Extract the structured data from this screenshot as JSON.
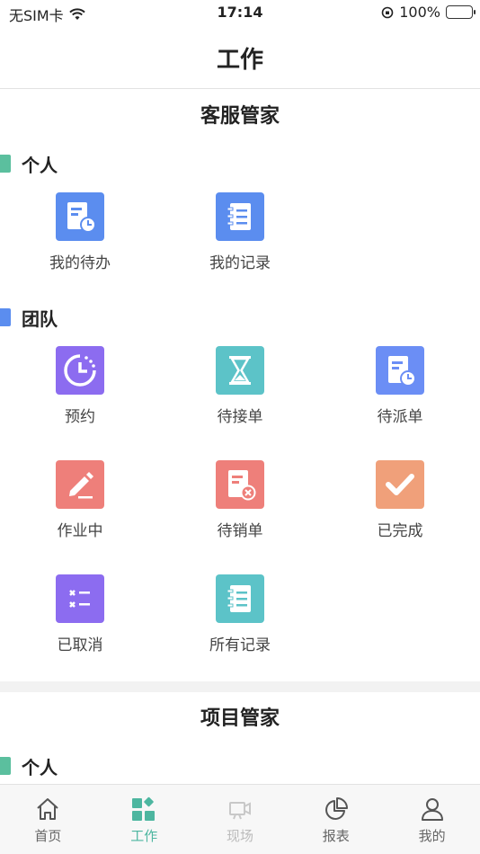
{
  "status": {
    "carrier": "无SIM卡",
    "time": "17:14",
    "battery": "100%",
    "battery_level": 1.0
  },
  "nav": {
    "title": "工作"
  },
  "sections": [
    {
      "title": "客服管家",
      "groups": [
        {
          "title": "个人",
          "bar_color": "#5bbf9e",
          "items": [
            {
              "label": "我的待办",
              "icon": "todo-clock-icon",
              "color": "#5b8def"
            },
            {
              "label": "我的记录",
              "icon": "record-book-icon",
              "color": "#5b8def"
            }
          ]
        },
        {
          "title": "团队",
          "bar_color": "#5b8def",
          "items": [
            {
              "label": "预约",
              "icon": "clock-icon",
              "color": "#8c6cf0"
            },
            {
              "label": "待接单",
              "icon": "hourglass-icon",
              "color": "#5cc3c8"
            },
            {
              "label": "待派单",
              "icon": "document-clock-icon",
              "color": "#6b8ef5"
            },
            {
              "label": "作业中",
              "icon": "pencil-icon",
              "color": "#ee7f7a"
            },
            {
              "label": "待销单",
              "icon": "document-cancel-icon",
              "color": "#ee7f7a"
            },
            {
              "label": "已完成",
              "icon": "checkmark-icon",
              "color": "#f0a07a"
            },
            {
              "label": "已取消",
              "icon": "cancel-list-icon",
              "color": "#8c6cf0"
            },
            {
              "label": "所有记录",
              "icon": "record-book-icon",
              "color": "#5cc3c8"
            }
          ]
        }
      ]
    },
    {
      "title": "项目管家",
      "groups": [
        {
          "title": "个人",
          "bar_color": "#5bbf9e",
          "items": []
        }
      ]
    }
  ],
  "tabs": [
    {
      "label": "首页",
      "icon": "home-icon",
      "state": "normal"
    },
    {
      "label": "工作",
      "icon": "apps-icon",
      "state": "active"
    },
    {
      "label": "现场",
      "icon": "camera-icon",
      "state": "disabled"
    },
    {
      "label": "报表",
      "icon": "pie-chart-icon",
      "state": "normal"
    },
    {
      "label": "我的",
      "icon": "user-icon",
      "state": "normal"
    }
  ],
  "colors": {
    "accent": "#4db6a0"
  }
}
